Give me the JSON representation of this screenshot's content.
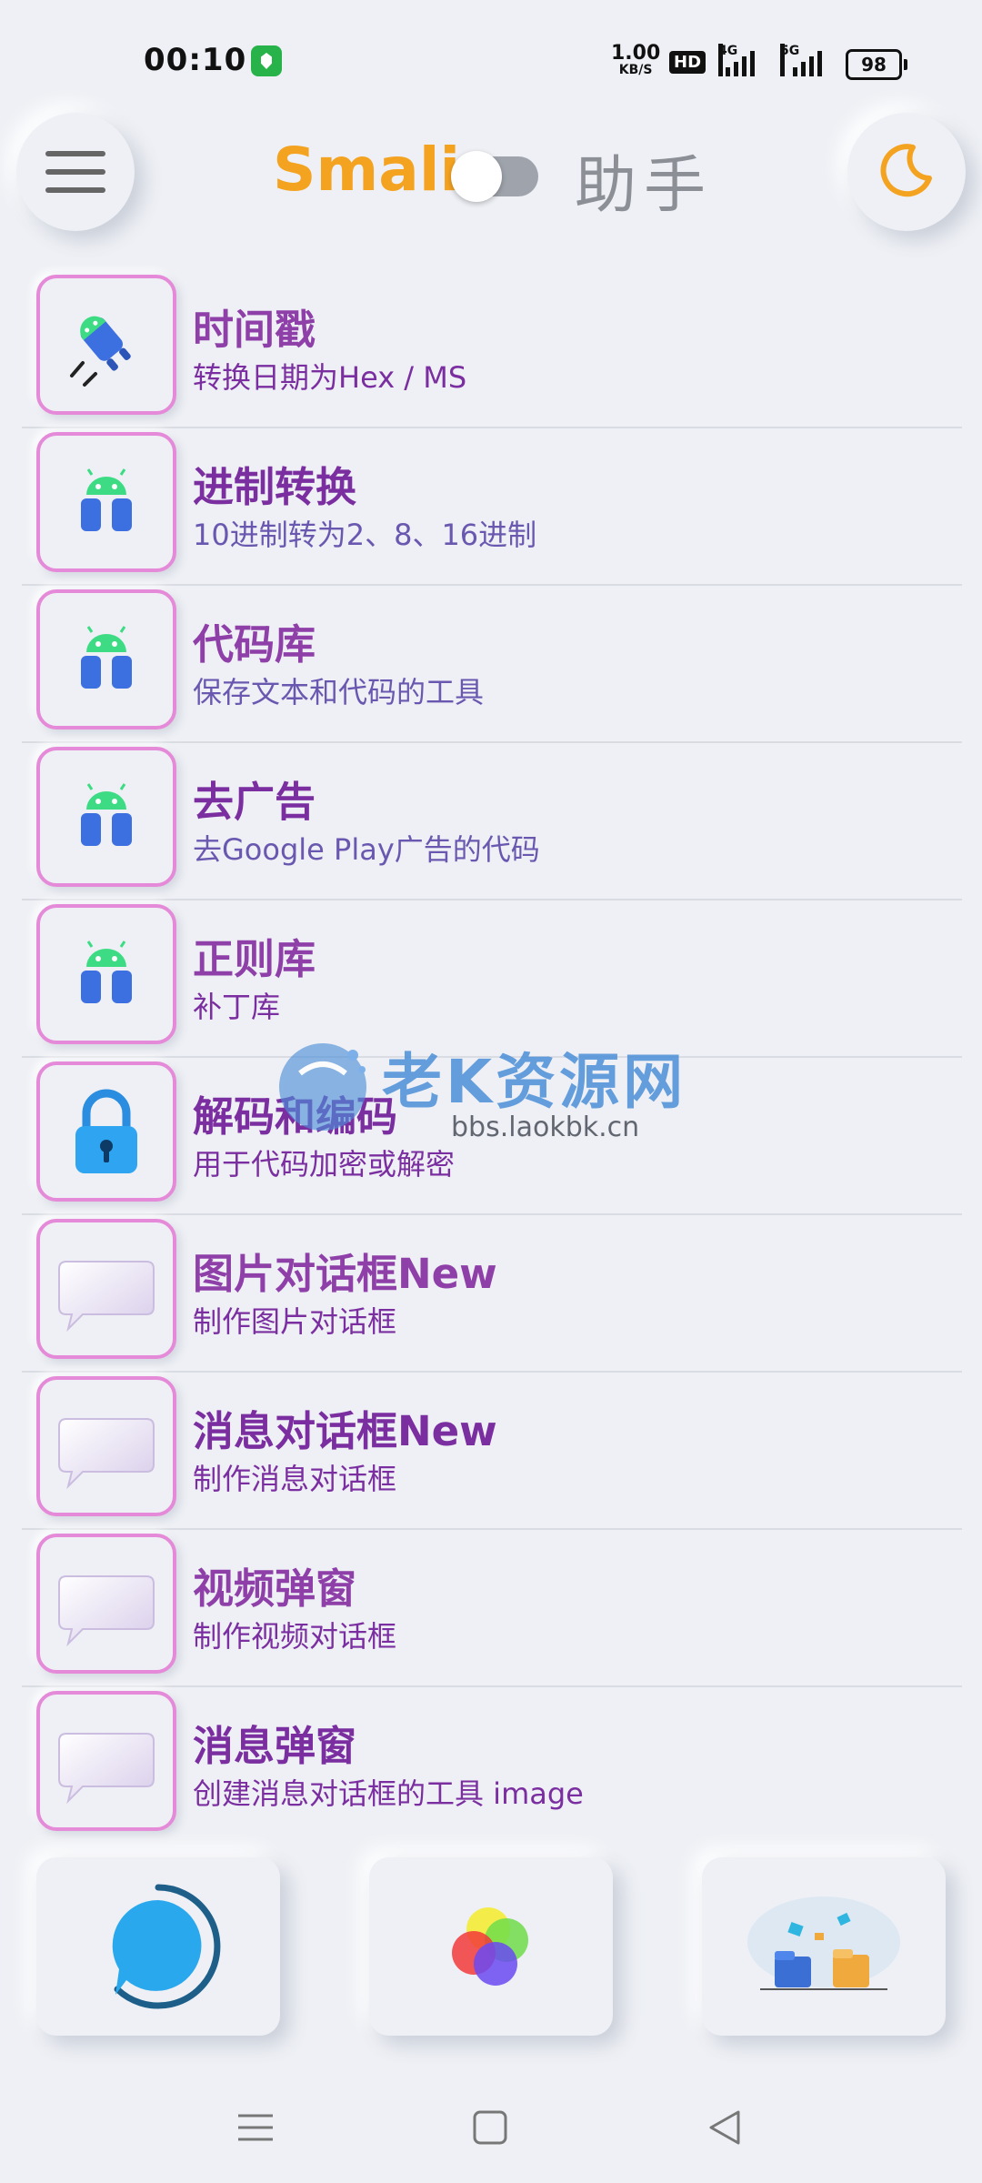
{
  "status_bar": {
    "time": "00:10",
    "net_speed": "1.00",
    "net_unit": "KB/S",
    "hd_label": "HD",
    "sim1_label": "4G",
    "sim2_label": "5G",
    "battery": "98"
  },
  "header": {
    "title_left": "Smali",
    "title_right": "助手",
    "menu_icon": "hamburger-menu-icon",
    "theme_icon": "moon-icon",
    "accent_color": "#f4a321"
  },
  "tools": [
    {
      "title": "时间戳",
      "subtitle": "转换日期为Hex / MS",
      "icon": "android-rocket-icon"
    },
    {
      "title": "进制转换",
      "subtitle": "10进制转为2、8、16进制",
      "icon": "android-robot-icon"
    },
    {
      "title": "代码库",
      "subtitle": "保存文本和代码的工具",
      "icon": "android-robot-icon"
    },
    {
      "title": "去广告",
      "subtitle": "去Google Play广告的代码",
      "icon": "android-robot-icon"
    },
    {
      "title": "正则库",
      "subtitle": "补丁库",
      "icon": "android-robot-icon"
    },
    {
      "title": "解码和编码",
      "subtitle": "用于代码加密或解密",
      "icon": "lock-icon"
    },
    {
      "title": "图片对话框New",
      "subtitle": "制作图片对话框",
      "icon": "dialog-bubble-icon"
    },
    {
      "title": "消息对话框New",
      "subtitle": "制作消息对话框",
      "icon": "dialog-bubble-icon"
    },
    {
      "title": "视频弹窗",
      "subtitle": "制作视频对话框",
      "icon": "dialog-bubble-icon"
    },
    {
      "title": "消息弹窗",
      "subtitle": "创建消息对话框的工具 image",
      "icon": "dialog-bubble-icon"
    }
  ],
  "watermark": {
    "title": "老K资源网",
    "url": "bbs.laokbk.cn"
  },
  "bottom_cards": [
    {
      "icon": "chat-bubble-icon"
    },
    {
      "icon": "color-circles-icon"
    },
    {
      "icon": "folders-illustration-icon"
    }
  ],
  "nav_bar": {
    "icons": [
      "recents-menu-icon",
      "home-square-icon",
      "back-triangle-icon"
    ]
  }
}
